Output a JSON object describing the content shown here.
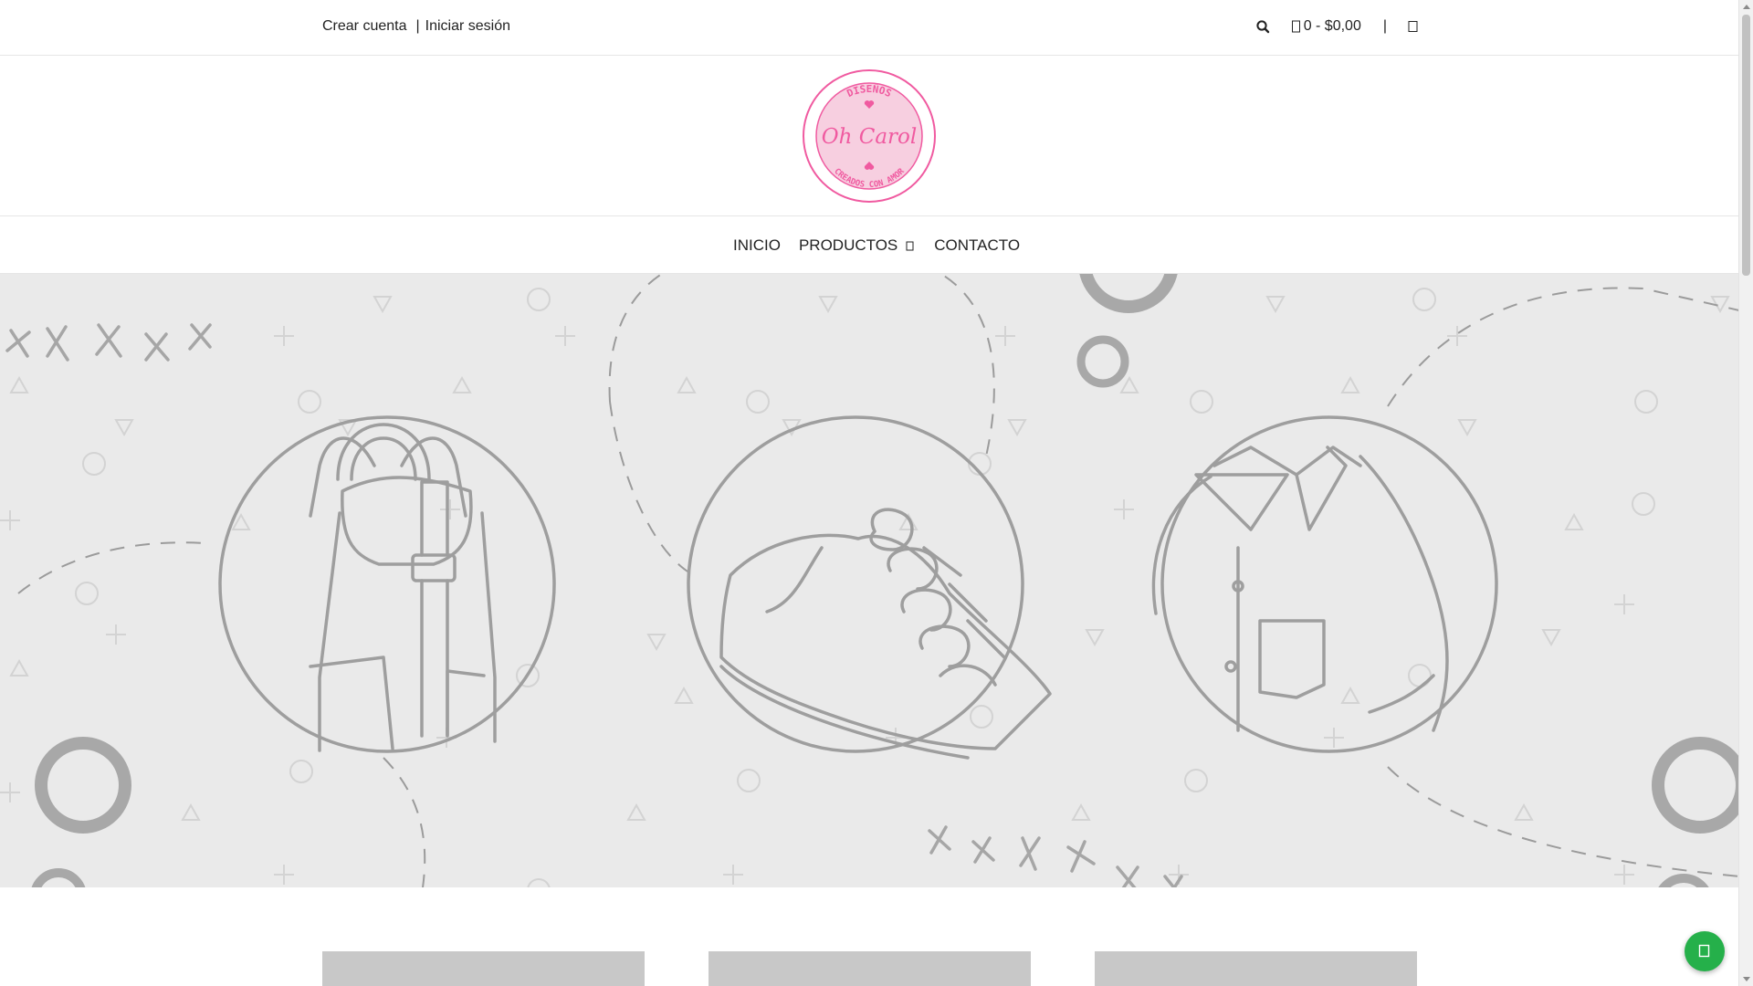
{
  "account": {
    "create_label": "Crear cuenta",
    "separator": "|",
    "login_label": "Iniciar sesión"
  },
  "header_tools": {
    "search_icon": "search-icon",
    "cart_icon": "cart-icon",
    "cart_label": "0 - $0,00",
    "separator": "|",
    "user_icon": "user-icon"
  },
  "logo": {
    "top_text": "DISEÑOS",
    "script_text": "Oh Carol",
    "bottom_text": "CREADOS CON AMOR",
    "brand_color": "#f05aa0",
    "fill_color": "#f7cfe0"
  },
  "nav": {
    "items": [
      {
        "label": "INICIO"
      },
      {
        "label": "PRODUCTOS",
        "has_dropdown": true
      },
      {
        "label": "CONTACTO"
      }
    ]
  },
  "hero": {
    "background_color": "#eaeaea",
    "line_color": "#a9a9a9",
    "icons": [
      "backpack-icon",
      "sneaker-icon",
      "shirt-icon"
    ]
  },
  "whatsapp": {
    "icon": "whatsapp-icon",
    "color": "#25b04a"
  }
}
